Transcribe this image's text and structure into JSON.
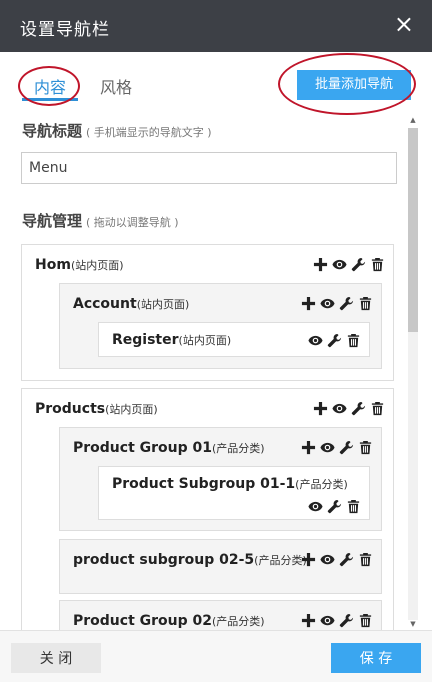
{
  "dialog": {
    "title": "设置导航栏",
    "close_symbol": "×"
  },
  "tabs": [
    {
      "label": "内容",
      "active": true
    },
    {
      "label": "风格",
      "active": false
    }
  ],
  "batch_add_label": "批量添加导航",
  "nav_title": {
    "label": "导航标题",
    "hint": "( 手机端显示的导航文字 )",
    "value": "Menu"
  },
  "nav_manage": {
    "label": "导航管理",
    "hint": "( 拖动以调整导航 )"
  },
  "nav_items": [
    {
      "name": "Hom",
      "type": "(站内页面)"
    },
    {
      "name": "Account",
      "type": "(站内页面)"
    },
    {
      "name": "Register",
      "type": "(站内页面)"
    },
    {
      "name": "Products",
      "type": "(站内页面)"
    },
    {
      "name": "Product Group 01",
      "type": "(产品分类)"
    },
    {
      "name": "Product Subgroup 01-1",
      "type": "(产品分类)"
    },
    {
      "name": "product subgroup 02-5",
      "type": "(产品分类)"
    },
    {
      "name": "Product Group 02",
      "type": "(产品分类)"
    }
  ],
  "icons": {
    "add": "plus-icon",
    "view": "eye-icon",
    "edit": "wrench-icon",
    "delete": "trash-icon"
  },
  "colors": {
    "titlebar": "#3d4046",
    "accent": "#3aa6f0",
    "highlight_ring": "#c0152a"
  },
  "footer": {
    "close_label": "关 闭",
    "save_label": "保 存"
  }
}
